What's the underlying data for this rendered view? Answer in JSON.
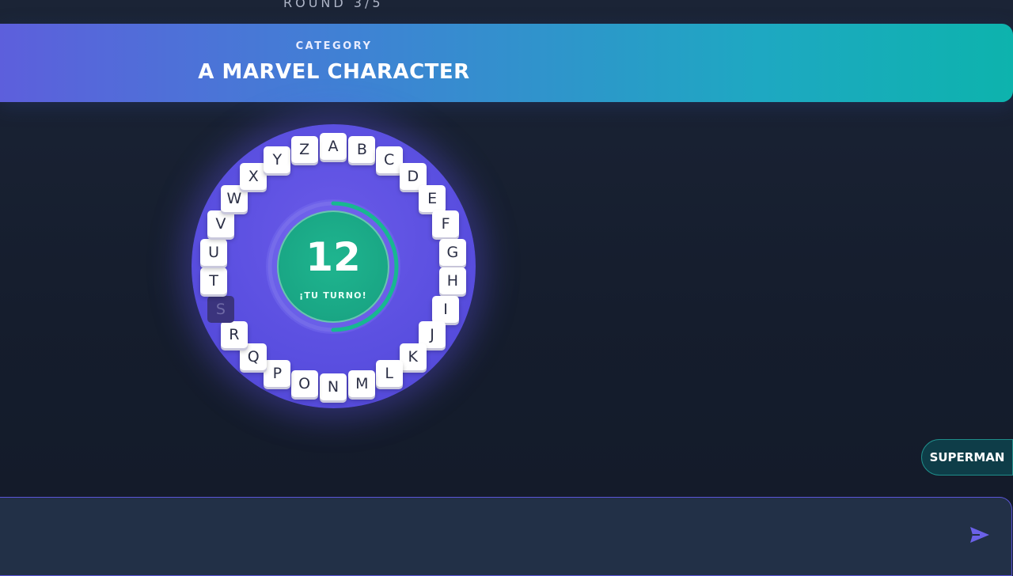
{
  "header": {
    "round_label": "ROUND 3/5"
  },
  "category": {
    "kicker": "CATEGORY",
    "title": "A MARVEL CHARACTER"
  },
  "timer": {
    "value": "12",
    "caption": "¡TU TURNO!",
    "progress": 0.5
  },
  "wheel": {
    "letters": [
      {
        "char": "A",
        "used": false
      },
      {
        "char": "B",
        "used": false
      },
      {
        "char": "C",
        "used": false
      },
      {
        "char": "D",
        "used": false
      },
      {
        "char": "E",
        "used": false
      },
      {
        "char": "F",
        "used": false
      },
      {
        "char": "G",
        "used": false
      },
      {
        "char": "H",
        "used": false
      },
      {
        "char": "I",
        "used": false
      },
      {
        "char": "J",
        "used": false
      },
      {
        "char": "K",
        "used": false
      },
      {
        "char": "L",
        "used": false
      },
      {
        "char": "M",
        "used": false
      },
      {
        "char": "N",
        "used": false
      },
      {
        "char": "O",
        "used": false
      },
      {
        "char": "P",
        "used": false
      },
      {
        "char": "Q",
        "used": false
      },
      {
        "char": "R",
        "used": false
      },
      {
        "char": "S",
        "used": true
      },
      {
        "char": "T",
        "used": false
      },
      {
        "char": "U",
        "used": false
      },
      {
        "char": "V",
        "used": false
      },
      {
        "char": "W",
        "used": false
      },
      {
        "char": "X",
        "used": false
      },
      {
        "char": "Y",
        "used": false
      },
      {
        "char": "Z",
        "used": false
      }
    ]
  },
  "guesses": [
    {
      "text": "SUPERMAN"
    }
  ],
  "answer": {
    "value": "",
    "placeholder": "",
    "send_icon": "send-icon"
  },
  "colors": {
    "accent": "#5d5fdc",
    "teal": "#0db3ad",
    "timer_green": "#1fb58f",
    "wheel": "#5a4fe0"
  }
}
